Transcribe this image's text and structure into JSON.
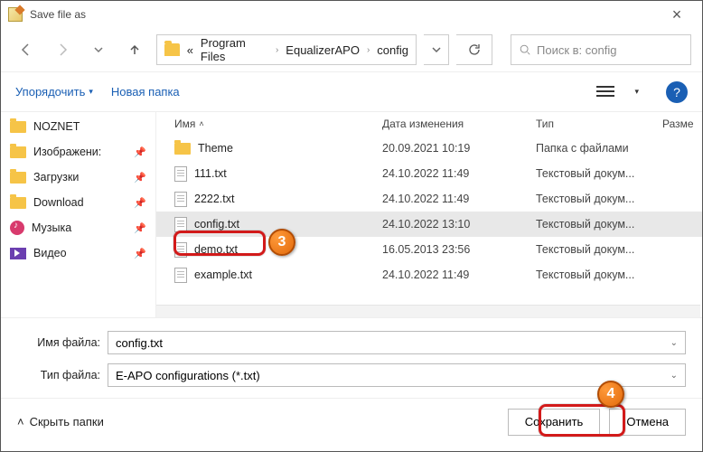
{
  "window": {
    "title": "Save file as"
  },
  "breadcrumbs": {
    "prefix": "«",
    "p1": "Program Files",
    "p2": "EqualizerAPO",
    "p3": "config"
  },
  "search": {
    "placeholder": "Поиск в: config"
  },
  "toolbar": {
    "organize": "Упорядочить",
    "newfolder": "Новая папка"
  },
  "columns": {
    "name": "Имя",
    "date": "Дата изменения",
    "type": "Тип",
    "size": "Разме"
  },
  "sidebar": {
    "items": [
      {
        "label": "NOZNET"
      },
      {
        "label": "Изображени:"
      },
      {
        "label": "Загрузки"
      },
      {
        "label": "Download"
      },
      {
        "label": "Музыка"
      },
      {
        "label": "Видео"
      }
    ]
  },
  "files": [
    {
      "name": "Theme",
      "date": "20.09.2021 10:19",
      "type": "Папка с файлами",
      "kind": "folder"
    },
    {
      "name": "111.txt",
      "date": "24.10.2022 11:49",
      "type": "Текстовый докум...",
      "kind": "txt"
    },
    {
      "name": "2222.txt",
      "date": "24.10.2022 11:49",
      "type": "Текстовый докум...",
      "kind": "txt"
    },
    {
      "name": "config.txt",
      "date": "24.10.2022 13:10",
      "type": "Текстовый докум...",
      "kind": "txt",
      "selected": true
    },
    {
      "name": "demo.txt",
      "date": "16.05.2013 23:56",
      "type": "Текстовый докум...",
      "kind": "txt"
    },
    {
      "name": "example.txt",
      "date": "24.10.2022 11:49",
      "type": "Текстовый докум...",
      "kind": "txt"
    }
  ],
  "form": {
    "filename_label": "Имя файла:",
    "filename_value": "config.txt",
    "filetype_label": "Тип файла:",
    "filetype_value": "E-APO configurations (*.txt)"
  },
  "buttons": {
    "hide": "Скрыть папки",
    "save": "Сохранить",
    "cancel": "Отмена"
  },
  "annotations": {
    "n3": "3",
    "n4": "4"
  }
}
